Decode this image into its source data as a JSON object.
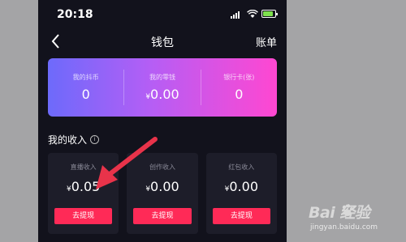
{
  "status_bar": {
    "time": "20:18"
  },
  "header": {
    "title": "钱包",
    "bill_label": "账单"
  },
  "balances": [
    {
      "label": "我的抖币",
      "currency": "",
      "amount": "0"
    },
    {
      "label": "我的零钱",
      "currency": "¥",
      "amount": "0.00"
    },
    {
      "label": "银行卡(张)",
      "currency": "",
      "amount": "0"
    }
  ],
  "income": {
    "title": "我的收入",
    "cards": [
      {
        "label": "直播收入",
        "currency": "¥",
        "amount": "0.05",
        "button": "去提现"
      },
      {
        "label": "创作收入",
        "currency": "¥",
        "amount": "0.00",
        "button": "去提现"
      },
      {
        "label": "红包收入",
        "currency": "¥",
        "amount": "0.00",
        "button": "去提现"
      }
    ]
  },
  "watermark": {
    "logo": "Bai 经验",
    "url": "jingyan.baidu.com"
  },
  "colors": {
    "accent": "#ff2a57",
    "annotation": "#e8334a",
    "card_gradient_start": "#6d6afb",
    "card_gradient_end": "#ff47d1"
  }
}
